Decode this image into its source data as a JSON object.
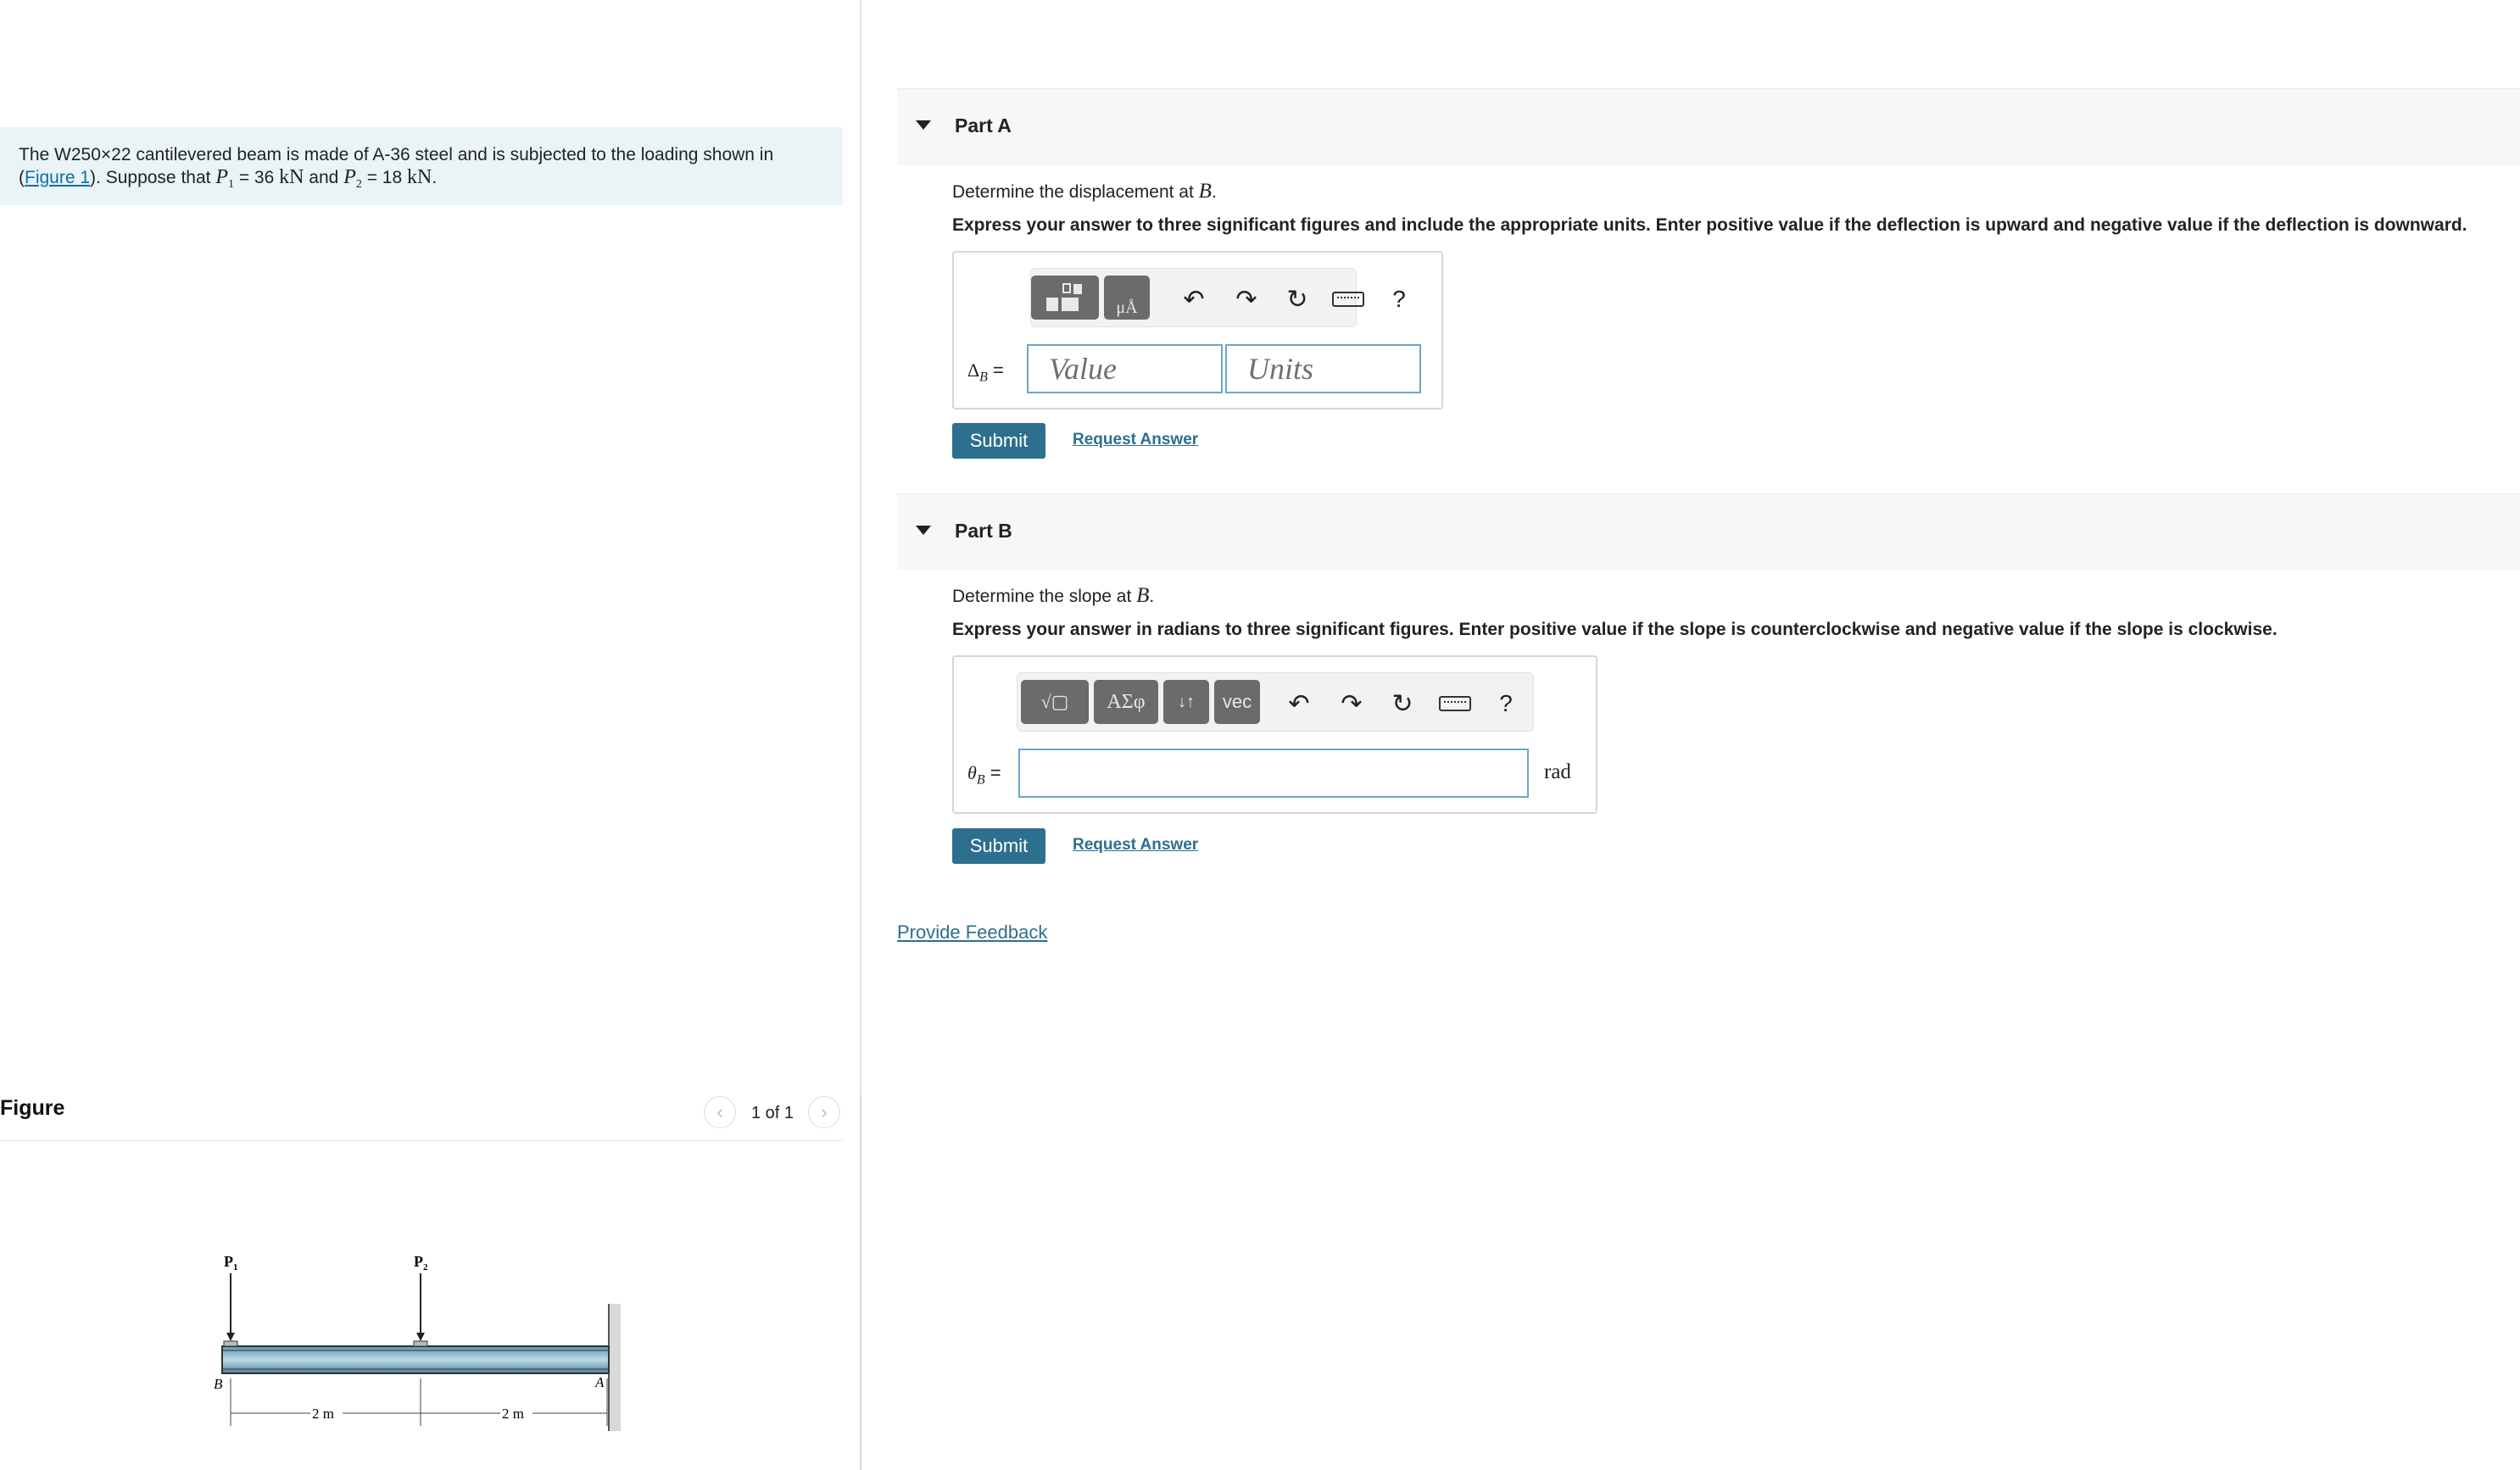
{
  "problem": {
    "text_before": "The W250",
    "times": "×",
    "text_after_shape": "22 cantilevered beam is made of A-36 steel and is subjected to the loading shown in (",
    "figure_link": "Figure 1",
    "text_suppose": "). Suppose that ",
    "p1_sym": "P",
    "p1_sub": "1",
    "p1_val": " = 36 ",
    "kN": "kN",
    "and": " and ",
    "p2_sym": "P",
    "p2_sub": "2",
    "p2_val": " = 18 ",
    "end": "."
  },
  "figure": {
    "label": "Figure",
    "counter": "1 of 1",
    "prev_glyph": "‹",
    "next_glyph": "›",
    "labels": {
      "p1": "P",
      "p1_sub": "1",
      "p2": "P",
      "p2_sub": "2",
      "b": "B",
      "a": "A",
      "dim1": "2 m",
      "dim2": "2 m"
    }
  },
  "partA": {
    "title": "Part A",
    "question_pre": "Determine the displacement at ",
    "question_var": "B",
    "question_end": ".",
    "instructions": "Express your answer to three significant figures and include the appropriate units. Enter positive value if the deflection is upward and negative value if the deflection is downward.",
    "var_delta": "Δ",
    "var_sub": "B",
    "eq": " =",
    "value_placeholder": "Value",
    "units_placeholder": "Units",
    "toolbar": {
      "tb2": "μÅ",
      "help": "?"
    },
    "submit": "Submit",
    "request": "Request Answer"
  },
  "partB": {
    "title": "Part B",
    "question_pre": "Determine the slope at ",
    "question_var": "B",
    "question_end": ".",
    "instructions": "Express your answer in radians to three significant figures. Enter positive value if the slope is counterclockwise and negative value if the slope is clockwise.",
    "var_theta": "θ",
    "var_sub": "B",
    "eq": " =",
    "unit": "rad",
    "toolbar": {
      "tb1": "√▢",
      "tb2": "ΑΣφ",
      "tb3": "↓↑",
      "tb4": "vec",
      "help": "?"
    },
    "submit": "Submit",
    "request": "Request Answer"
  },
  "feedback": "Provide Feedback",
  "colors": {
    "accent": "#2c6f8f",
    "problem_bg": "#eaf4f6",
    "input_border": "#6ba6c6"
  }
}
